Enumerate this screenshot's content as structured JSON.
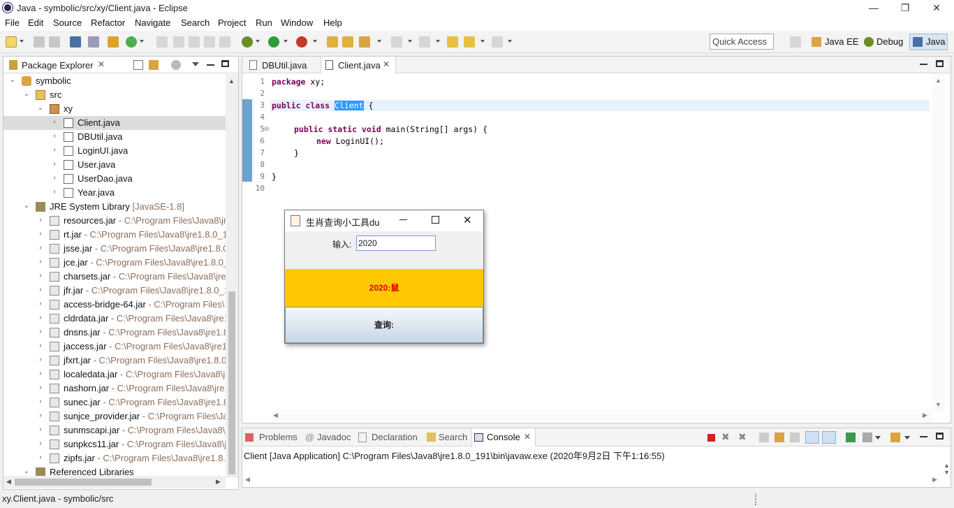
{
  "window": {
    "title": "Java - symbolic/src/xy/Client.java - Eclipse",
    "minimize": "—",
    "restore": "❐",
    "close": "✕"
  },
  "menu": [
    "File",
    "Edit",
    "Source",
    "Refactor",
    "Navigate",
    "Search",
    "Project",
    "Run",
    "Window",
    "Help"
  ],
  "toolbar": {
    "quick_access_placeholder": "Quick Access",
    "perspectives": [
      "Java EE",
      "Debug",
      "Java"
    ]
  },
  "package_explorer": {
    "title": "Package Explorer",
    "tree": [
      {
        "label": "symbolic",
        "icon": "project-icon"
      },
      {
        "label": "src",
        "icon": "source-folder-icon"
      },
      {
        "label": "xy",
        "icon": "package-icon"
      },
      {
        "label": "Client.java",
        "icon": "java-file-icon"
      },
      {
        "label": "DBUtil.java",
        "icon": "java-file-icon"
      },
      {
        "label": "LoginUI.java",
        "icon": "java-file-icon"
      },
      {
        "label": "User.java",
        "icon": "java-file-icon"
      },
      {
        "label": "UserDao.java",
        "icon": "java-file-icon"
      },
      {
        "label": "Year.java",
        "icon": "java-file-icon"
      },
      {
        "label": "JRE System Library",
        "suffix": "[JavaSE-1.8]",
        "icon": "library-icon"
      },
      {
        "label": "resources.jar",
        "suffix": " - C:\\Program Files\\Java8\\jre",
        "icon": "jar-icon"
      },
      {
        "label": "rt.jar",
        "suffix": " - C:\\Program Files\\Java8\\jre1.8.0_19",
        "icon": "jar-icon"
      },
      {
        "label": "jsse.jar",
        "suffix": " - C:\\Program Files\\Java8\\jre1.8.0_",
        "icon": "jar-icon"
      },
      {
        "label": "jce.jar",
        "suffix": " - C:\\Program Files\\Java8\\jre1.8.0_",
        "icon": "jar-icon"
      },
      {
        "label": "charsets.jar",
        "suffix": " - C:\\Program Files\\Java8\\jre1",
        "icon": "jar-icon"
      },
      {
        "label": "jfr.jar",
        "suffix": " - C:\\Program Files\\Java8\\jre1.8.0_1",
        "icon": "jar-icon"
      },
      {
        "label": "access-bridge-64.jar",
        "suffix": " - C:\\Program Files\\",
        "icon": "jar-icon"
      },
      {
        "label": "cldrdata.jar",
        "suffix": " - C:\\Program Files\\Java8\\jre1",
        "icon": "jar-icon"
      },
      {
        "label": "dnsns.jar",
        "suffix": " - C:\\Program Files\\Java8\\jre1.8",
        "icon": "jar-icon"
      },
      {
        "label": "jaccess.jar",
        "suffix": " - C:\\Program Files\\Java8\\jre1.",
        "icon": "jar-icon"
      },
      {
        "label": "jfxrt.jar",
        "suffix": " - C:\\Program Files\\Java8\\jre1.8.0_",
        "icon": "jar-icon"
      },
      {
        "label": "localedata.jar",
        "suffix": " - C:\\Program Files\\Java8\\j",
        "icon": "jar-icon"
      },
      {
        "label": "nashorn.jar",
        "suffix": " - C:\\Program Files\\Java8\\jre1",
        "icon": "jar-icon"
      },
      {
        "label": "sunec.jar",
        "suffix": " - C:\\Program Files\\Java8\\jre1.8",
        "icon": "jar-icon"
      },
      {
        "label": "sunjce_provider.jar",
        "suffix": " - C:\\Program Files\\Java8",
        "icon": "jar-icon"
      },
      {
        "label": "sunmscapi.jar",
        "suffix": " - C:\\Program Files\\Java8\\j",
        "icon": "jar-icon"
      },
      {
        "label": "sunpkcs11.jar",
        "suffix": " - C:\\Program Files\\Java8\\j",
        "icon": "jar-icon"
      },
      {
        "label": "zipfs.jar",
        "suffix": " - C:\\Program Files\\Java8\\jre1.8.0",
        "icon": "jar-icon"
      },
      {
        "label": "Referenced Libraries",
        "icon": "library-icon"
      }
    ]
  },
  "editor": {
    "tabs": [
      "DBUtil.java",
      "Client.java"
    ],
    "line_numbers": [
      "1",
      "2",
      "3",
      "4",
      "5",
      "6",
      "7",
      "8",
      "9",
      "10"
    ],
    "code": {
      "l1_kw": "package",
      "l1_rest": " xy;",
      "l3_kw": "public class",
      "l3_sel": "Client",
      "l3_rest": " {",
      "l5_kw": "public static void",
      "l5_rest": " main(String[] args) {",
      "l6_kw": "new",
      "l6_rest": " LoginUI();",
      "l7": "}",
      "l9": "}"
    }
  },
  "dialog": {
    "title": "生肖查询小工具du",
    "input_label": "输入:",
    "input_value": "2020",
    "result": "2020:鼠",
    "button": "查询:"
  },
  "console": {
    "tabs": [
      "Problems",
      "Javadoc",
      "Declaration",
      "Search",
      "Console"
    ],
    "header": "Client [Java Application] C:\\Program Files\\Java8\\jre1.8.0_191\\bin\\javaw.exe (2020年9月2日 下午1:16:55)"
  },
  "status": {
    "text": "xy.Client.java - symbolic/src"
  },
  "colors": {
    "keyword": "#7f0055",
    "selection": "#3399ff",
    "result_bg": "#ffc800",
    "result_text": "#e00000"
  }
}
